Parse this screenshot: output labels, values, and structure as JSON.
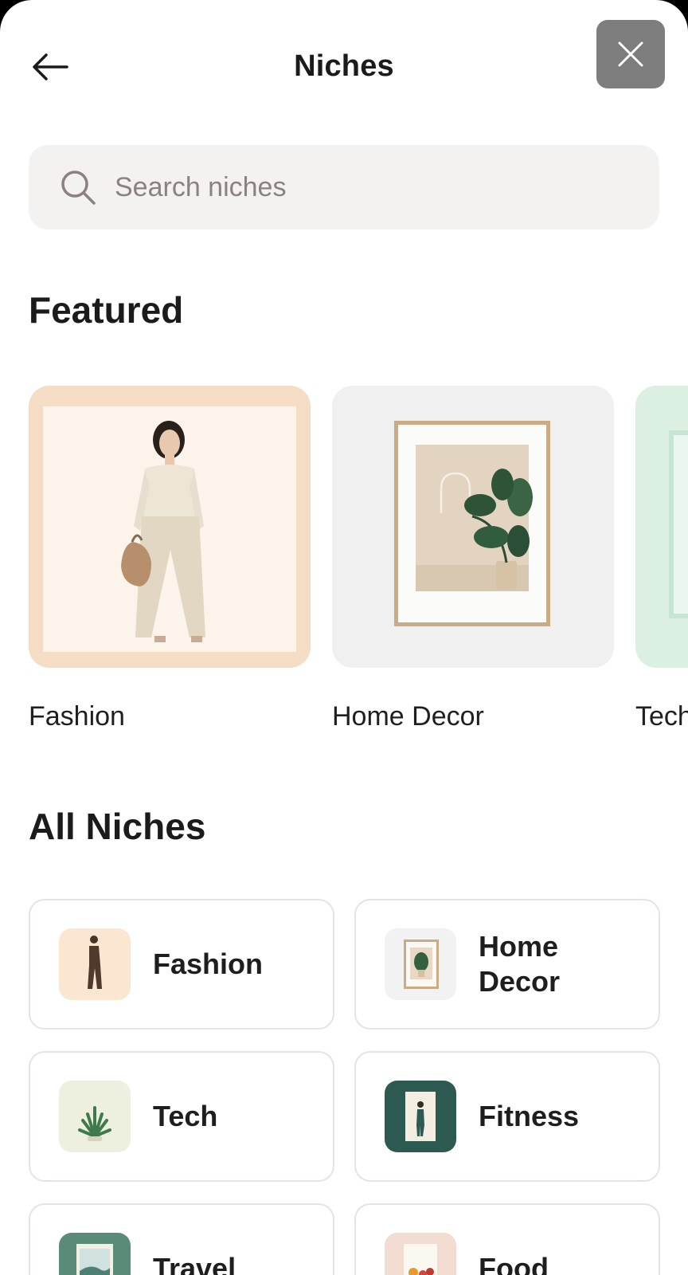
{
  "header": {
    "title": "Niches",
    "back_icon": "arrow-left-icon",
    "close_icon": "close-icon",
    "close_bg": "#7d7d7d"
  },
  "search": {
    "placeholder": "Search niches",
    "icon": "search-icon"
  },
  "featured": {
    "title": "Featured",
    "items": [
      {
        "label": "Fashion",
        "bg": "#f4dcc5"
      },
      {
        "label": "Home Decor",
        "bg": "#f0f0f0"
      },
      {
        "label": "Tech",
        "bg": "#dcefe3"
      }
    ]
  },
  "all_niches": {
    "title": "All Niches",
    "items": [
      {
        "label": "Fashion",
        "thumb_bg": "#fbe6d2"
      },
      {
        "label": "Home Decor",
        "thumb_bg": "#f2f2f2"
      },
      {
        "label": "Tech",
        "thumb_bg": "#eef0df"
      },
      {
        "label": "Fitness",
        "thumb_bg": "#2c5a50"
      },
      {
        "label": "Travel",
        "thumb_bg": "#5a8a78"
      },
      {
        "label": "Food",
        "thumb_bg": "#f2dcd2"
      }
    ]
  }
}
